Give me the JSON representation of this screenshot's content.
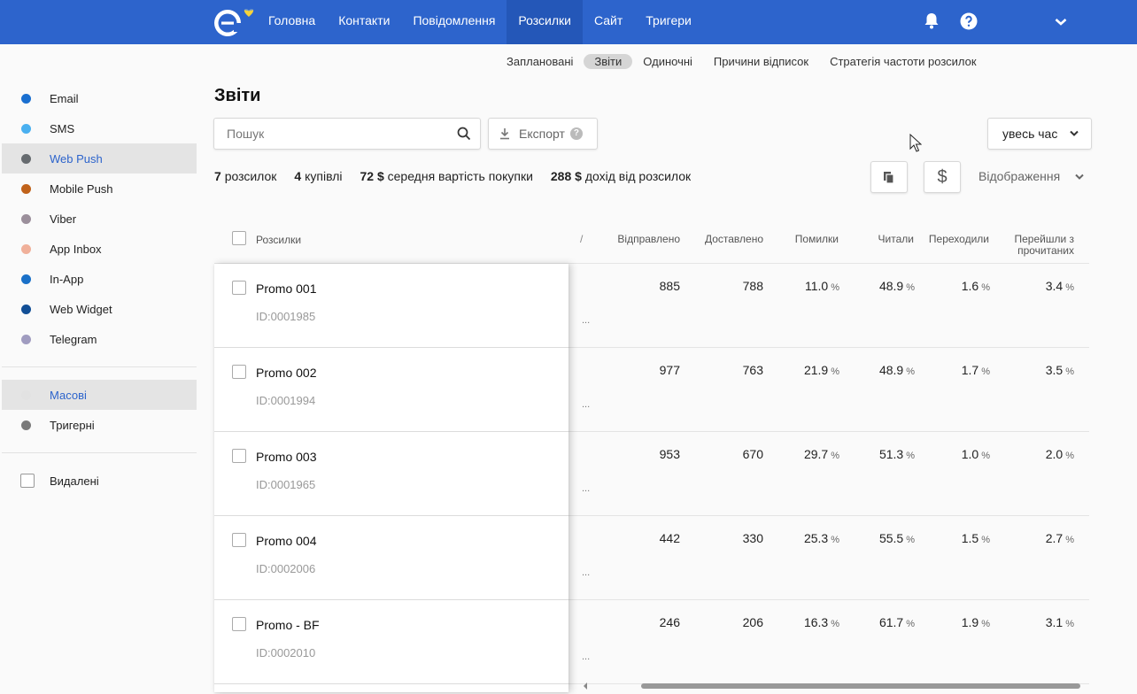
{
  "topnav": {
    "items": [
      {
        "label": "Головна",
        "active": false
      },
      {
        "label": "Контакти",
        "active": false
      },
      {
        "label": "Повідомлення",
        "active": false
      },
      {
        "label": "Розсилки",
        "active": true
      },
      {
        "label": "Сайт",
        "active": false
      },
      {
        "label": "Тригери",
        "active": false
      }
    ]
  },
  "subnav": {
    "items": [
      {
        "label": "Заплановані",
        "active": false
      },
      {
        "label": "Звіти",
        "active": true
      },
      {
        "label": "Одиночні",
        "active": false
      },
      {
        "label": "Причини відписок",
        "active": false
      },
      {
        "label": "Стратегія частоти розсилок",
        "active": false
      }
    ]
  },
  "sidebar": {
    "channels": [
      {
        "label": "Email",
        "color": "#1a6fd0"
      },
      {
        "label": "SMS",
        "color": "#4ab0f0"
      },
      {
        "label": "Web Push",
        "color": "#666b6f",
        "active": true
      },
      {
        "label": "Mobile Push",
        "color": "#c0621a"
      },
      {
        "label": "Viber",
        "color": "#9b8f9b"
      },
      {
        "label": "App Inbox",
        "color": "#f0b09a"
      },
      {
        "label": "In-App",
        "color": "#1a70c8"
      },
      {
        "label": "Web Widget",
        "color": "#124f96"
      },
      {
        "label": "Telegram",
        "color": "#a09cc0"
      }
    ],
    "types": [
      {
        "label": "Масові",
        "color": "#e2e2e2",
        "active": true
      },
      {
        "label": "Тригерні",
        "color": "#7a7a7a"
      }
    ],
    "deleted_label": "Видалені"
  },
  "page": {
    "title": "Звіти",
    "search_placeholder": "Пошук",
    "export_label": "Експорт",
    "help_glyph": "?",
    "period_label": "увесь час",
    "display_label": "Відображення",
    "currency_button": "$"
  },
  "stats": [
    {
      "value": "7",
      "label": "розсилок"
    },
    {
      "value": "4",
      "label": "купівлі"
    },
    {
      "value": "72 $",
      "label": "середня вартість покупки"
    },
    {
      "value": "288 $",
      "label": "дохід від розсилок"
    }
  ],
  "table": {
    "first_header": "Розсилки",
    "partial_header": "/",
    "headers": [
      "Відправлено",
      "Доставлено",
      "Помилки",
      "Читали",
      "Переходили",
      "Перейшли з прочитаних"
    ],
    "pct_sign": "%",
    "ellipsis": "...",
    "rows": [
      {
        "name": "Promo 001",
        "id": "ID:0001985",
        "sent": "885",
        "delivered": "788",
        "errors": "11.0",
        "read": "48.9",
        "clicked": "1.6",
        "ctr_read": "3.4"
      },
      {
        "name": "Promo 002",
        "id": "ID:0001994",
        "sent": "977",
        "delivered": "763",
        "errors": "21.9",
        "read": "48.9",
        "clicked": "1.7",
        "ctr_read": "3.5"
      },
      {
        "name": "Promo 003",
        "id": "ID:0001965",
        "sent": "953",
        "delivered": "670",
        "errors": "29.7",
        "read": "51.3",
        "clicked": "1.0",
        "ctr_read": "2.0"
      },
      {
        "name": "Promo 004",
        "id": "ID:0002006",
        "sent": "442",
        "delivered": "330",
        "errors": "25.3",
        "read": "55.5",
        "clicked": "1.5",
        "ctr_read": "2.7"
      },
      {
        "name": "Promo - BF",
        "id": "ID:0002010",
        "sent": "246",
        "delivered": "206",
        "errors": "16.3",
        "read": "61.7",
        "clicked": "1.9",
        "ctr_read": "3.1"
      }
    ]
  }
}
